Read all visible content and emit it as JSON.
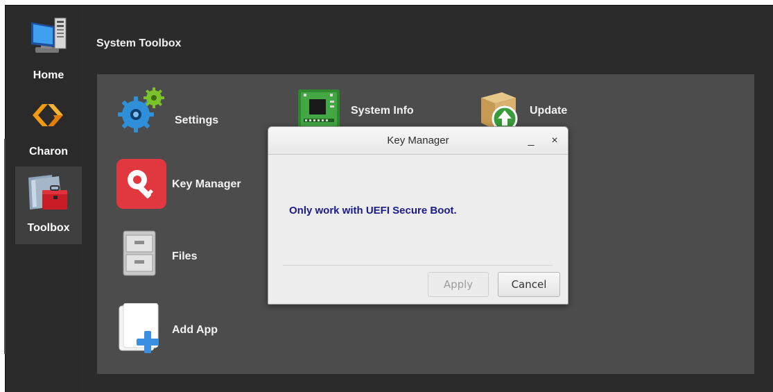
{
  "sidebar": {
    "items": [
      {
        "label": "Home",
        "icon": "home-computer-icon",
        "active": false
      },
      {
        "label": "Charon",
        "icon": "charon-logo-icon",
        "active": false
      },
      {
        "label": "Toolbox",
        "icon": "toolbox-icon",
        "active": true
      }
    ]
  },
  "main": {
    "title": "System Toolbox",
    "apps": [
      {
        "label": "Settings",
        "icon": "gears-icon"
      },
      {
        "label": "System Info",
        "icon": "circuit-board-icon"
      },
      {
        "label": "Update",
        "icon": "package-update-icon"
      },
      {
        "label": "Key Manager",
        "icon": "key-icon"
      },
      {
        "label": "Files",
        "icon": "file-cabinet-icon"
      },
      {
        "label": "Add App",
        "icon": "add-app-icon"
      }
    ]
  },
  "dialog": {
    "title": "Key Manager",
    "minimize": "_",
    "close": "×",
    "message": "Only work with UEFI Secure Boot.",
    "apply_label": "Apply",
    "cancel_label": "Cancel"
  },
  "colors": {
    "sidebar_bg": "#2a2a2a",
    "panel_bg": "#4c4c4c",
    "message": "#1a1a8c",
    "key_icon_bg": "#e0383e"
  }
}
